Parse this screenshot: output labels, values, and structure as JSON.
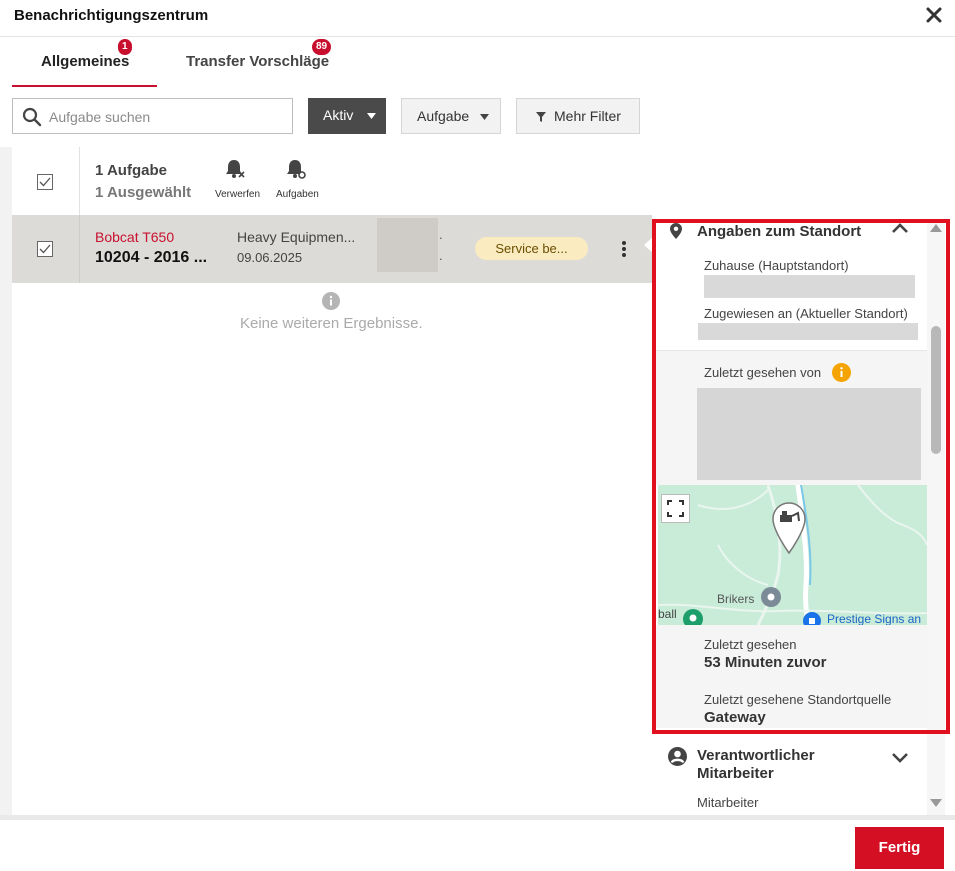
{
  "window": {
    "title": "Benachrichtigungszentrum"
  },
  "tabs": [
    {
      "label": "Allgemeines",
      "badge": "1",
      "active": true
    },
    {
      "label": "Transfer Vorschläge",
      "badge": "89",
      "active": false
    }
  ],
  "toolbar": {
    "search_placeholder": "Aufgabe suchen",
    "status_label": "Aktiv",
    "type_label": "Aufgabe",
    "filter_label": "Mehr Filter"
  },
  "summary": {
    "count": "1 Aufgabe",
    "selected": "1 Ausgewählt",
    "dismiss_label": "Verwerfen",
    "tasks_label": "Aufgaben"
  },
  "row": {
    "model": "Bobcat T650",
    "identifier": "10204 - 2016 ...",
    "category": "Heavy Equipmen...",
    "date": "09.06.2025",
    "status": "Service be...",
    "extra_dots": "."
  },
  "list": {
    "empty_text": "Keine weiteren Ergebnisse."
  },
  "panel": {
    "location_title": "Angaben zum Standort",
    "home_label": "Zuhause (Hauptstandort)",
    "assigned_label": "Zugewiesen an (Aktueller Standort)",
    "last_seen_by_label": "Zuletzt gesehen von",
    "map": {
      "place_1": "Brikers",
      "place_2": "Prestige Signs an",
      "place_3": "ball"
    },
    "last_seen_label": "Zuletzt gesehen",
    "last_seen_value": "53 Minuten zuvor",
    "source_label": "Zuletzt gesehene Standortquelle",
    "source_value": "Gateway",
    "responsible_title_1": "Verantwortlicher",
    "responsible_title_2": "Mitarbeiter",
    "employee_label": "Mitarbeiter"
  },
  "footer": {
    "done_label": "Fertig"
  },
  "colors": {
    "accent": "#c8102e",
    "done_button": "#d40f23",
    "status_pill": "#faecc0",
    "info": "#f5a300",
    "map_bg": "#c9ecd9"
  }
}
